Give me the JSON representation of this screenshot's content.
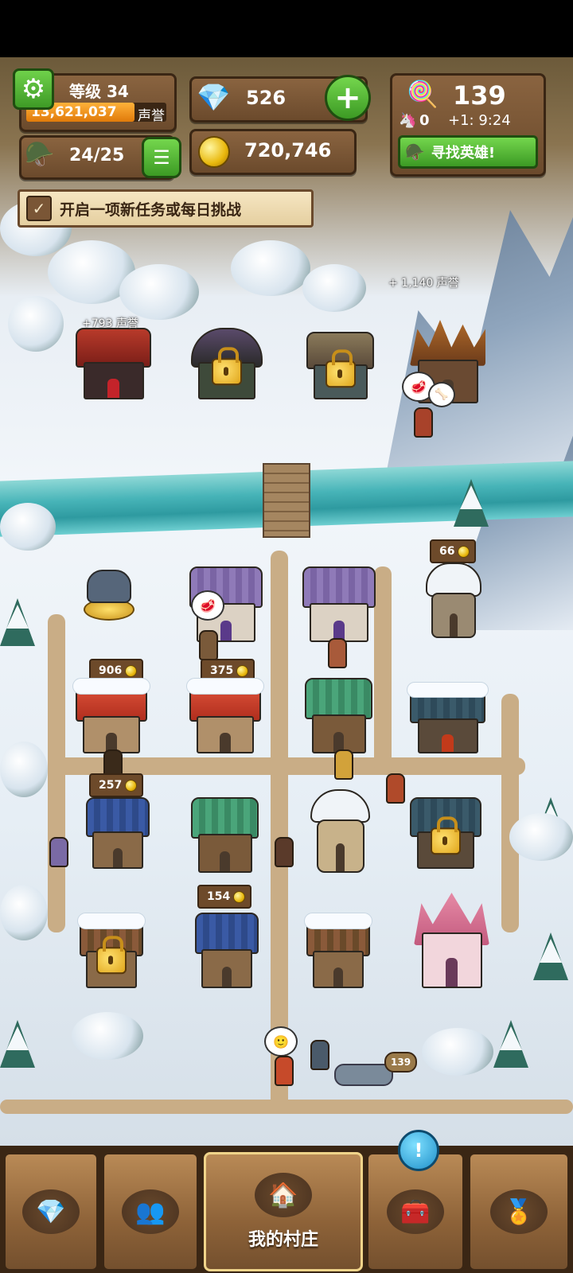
{
  "hud": {
    "level_label": "等级 34",
    "reputation_value": "13,621,037",
    "reputation_unit": "声誉",
    "gems": "526",
    "heroes_count": "24/25",
    "gold": "720,746",
    "candy": "139",
    "unicorns": "0",
    "timer": "+1: 9:24",
    "find_hero_label": "寻找英雄!"
  },
  "quest": {
    "label": "开启一项新任务或每日挑战"
  },
  "world": {
    "float_rep_left": "+793 声誉",
    "float_rep_right": "+ 1,140 声誉",
    "buildings": [
      {
        "id": "tower-top-right",
        "income": "66"
      },
      {
        "id": "house-left-1",
        "income": "906"
      },
      {
        "id": "house-left-2",
        "income": "375"
      },
      {
        "id": "blue-house",
        "income": "257"
      },
      {
        "id": "blue-house-2",
        "income": "154"
      },
      {
        "id": "basket",
        "income": "139"
      }
    ]
  },
  "nav": {
    "tabs": [
      {
        "id": "gems",
        "icon": "diamond-icon",
        "label": ""
      },
      {
        "id": "heroes",
        "icon": "people-icon",
        "label": ""
      },
      {
        "id": "village",
        "icon": "house-icon",
        "label": "我的村庄"
      },
      {
        "id": "chest",
        "icon": "chest-icon",
        "label": ""
      },
      {
        "id": "medal",
        "icon": "medal-icon",
        "label": ""
      }
    ],
    "alert_symbol": "!"
  },
  "colors": {
    "accent_green": "#3e9a26",
    "panel_brown": "#6b4a2c",
    "gold": "#e9b90e"
  }
}
